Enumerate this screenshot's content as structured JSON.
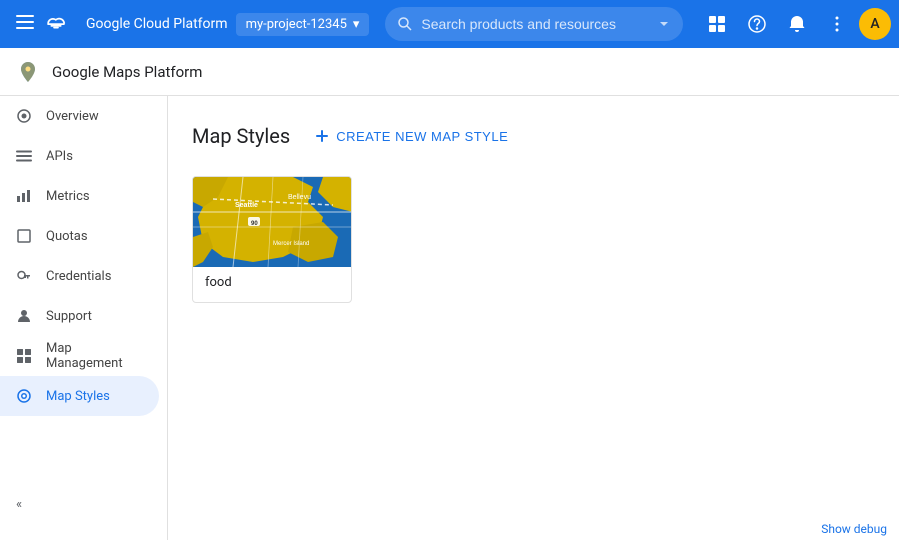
{
  "topbar": {
    "title": "Google Cloud Platform",
    "project_name": "my-project-12345",
    "search_placeholder": "Search products and resources",
    "chevron_down": "▾"
  },
  "subheader": {
    "title": "Google Maps Platform",
    "page_title": "Map Styles"
  },
  "sidebar": {
    "items": [
      {
        "id": "overview",
        "label": "Overview",
        "icon": "⊙"
      },
      {
        "id": "apis",
        "label": "APIs",
        "icon": "≡"
      },
      {
        "id": "metrics",
        "label": "Metrics",
        "icon": "▦"
      },
      {
        "id": "quotas",
        "label": "Quotas",
        "icon": "☐"
      },
      {
        "id": "credentials",
        "label": "Credentials",
        "icon": "⚿"
      },
      {
        "id": "support",
        "label": "Support",
        "icon": "👤"
      },
      {
        "id": "map-management",
        "label": "Map Management",
        "icon": "⊞"
      },
      {
        "id": "map-styles",
        "label": "Map Styles",
        "icon": "◉",
        "active": true
      }
    ],
    "collapse_label": "«"
  },
  "page": {
    "title": "Map Styles",
    "create_button_label": "CREATE NEW MAP STYLE",
    "create_button_icon": "+"
  },
  "map_styles": [
    {
      "id": "food",
      "label": "food",
      "has_thumbnail": true
    }
  ],
  "bottom_bar": {
    "debug_label": "Show debug"
  }
}
